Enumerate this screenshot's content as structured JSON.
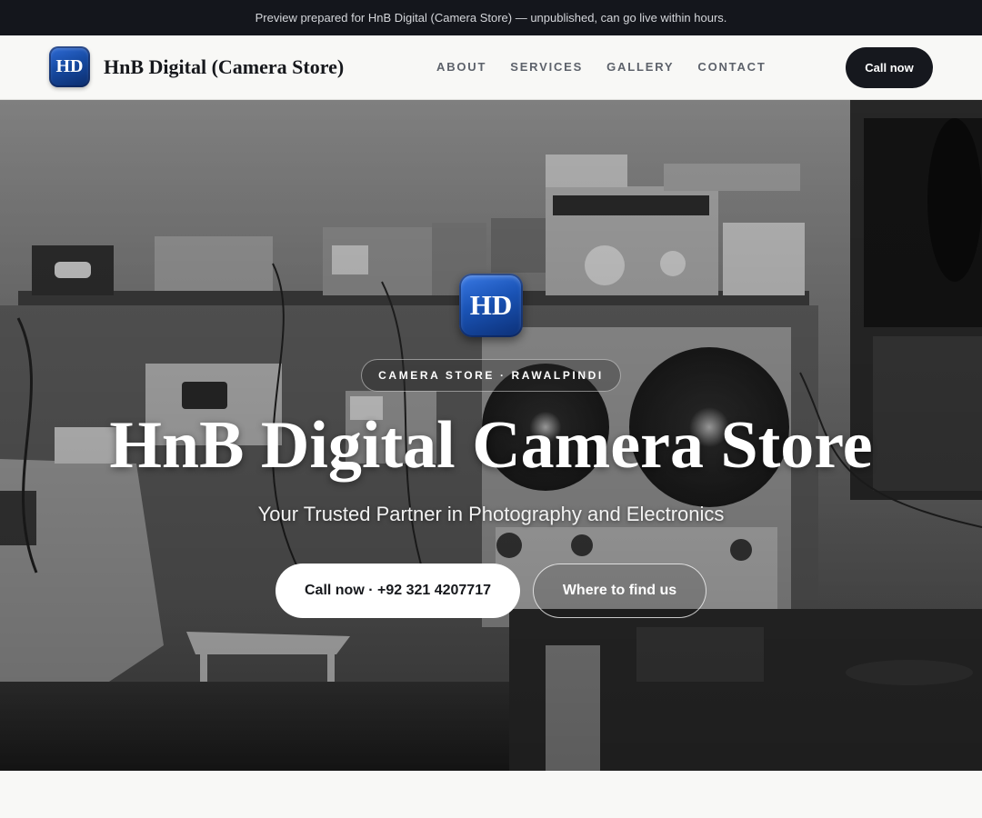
{
  "preview_banner": {
    "text": "Preview prepared for HnB Digital (Camera Store) — unpublished, can go live within hours."
  },
  "navbar": {
    "logo_text": "HD",
    "brand_name": "HnB Digital (Camera Store)",
    "links": [
      "ABOUT",
      "SERVICES",
      "GALLERY",
      "CONTACT"
    ],
    "cta_label": "Call now"
  },
  "hero": {
    "logo_text": "HD",
    "eyebrow": "CAMERA STORE · RAWALPINDI",
    "title": "HnB Digital Camera Store",
    "subtitle": "Your Trusted Partner in Photography and Electronics",
    "primary_button": "Call now · +92 321 4207717",
    "secondary_button": "Where to find us",
    "background_description_icon": "electronics-workshop-photo"
  },
  "colors": {
    "topbar_bg": "#14161c",
    "nav_bg": "#f8f8f6",
    "cta_bg": "#16181e",
    "logo_blue": "#174ba3",
    "nav_link": "#5d626b"
  }
}
